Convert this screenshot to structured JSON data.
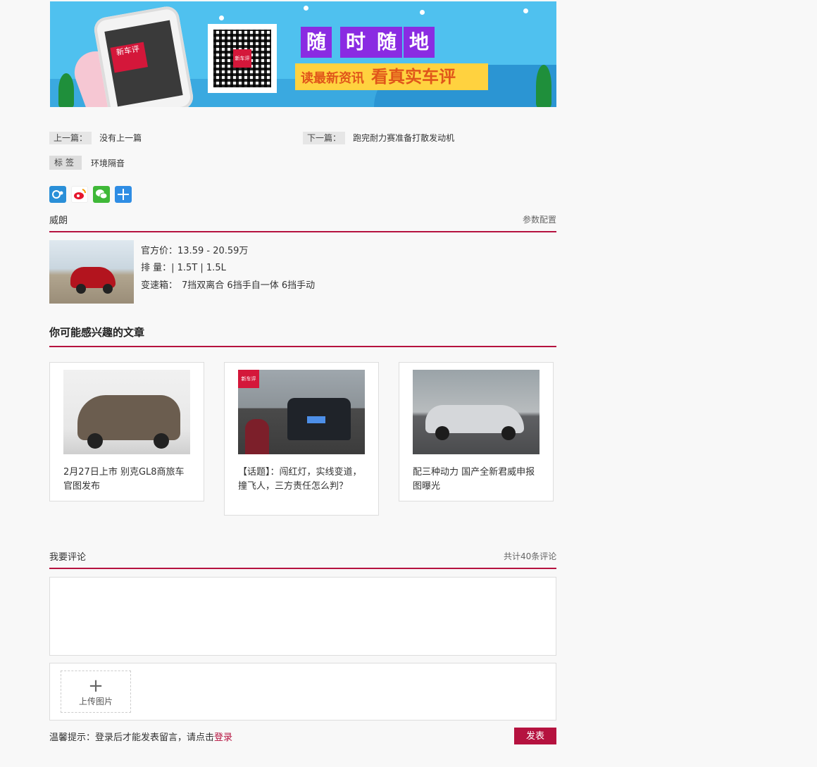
{
  "banner": {
    "phone_logo": "新车评",
    "qr_logo": "新车评",
    "slogan_chars": [
      "随",
      "时",
      "随",
      "地"
    ],
    "sub_small": "读最新资讯",
    "sub_large": "看真实车评"
  },
  "nav": {
    "prev_label": "上一篇：",
    "prev_text": "没有上一篇",
    "next_label": "下一篇：",
    "next_text": "跑完耐力赛准备打散发动机"
  },
  "tags": {
    "label": "标签",
    "items": [
      "环境隔音"
    ]
  },
  "share": {
    "icons": [
      "qzone-icon",
      "weibo-icon",
      "wechat-icon",
      "more-share-icon"
    ]
  },
  "car": {
    "name": "威朗",
    "params_link": "参数配置",
    "price_label": "官方价：",
    "price_value": "13.59 - 20.59万",
    "displacement_label": "排 量：",
    "displacement_value": "| 1.5T | 1.5L",
    "gearbox_label": "变速箱：",
    "gearbox_value": "7挡双离合 6挡手自一体 6挡手动"
  },
  "related": {
    "title": "你可能感兴趣的文章",
    "articles": [
      {
        "caption": "2月27日上市 别克GL8商旅车官图发布"
      },
      {
        "caption": "【话题】：闯红灯，实线变道，撞飞人，三方责任怎么判？"
      },
      {
        "caption": "配三种动力 国产全新君威申报图曝光"
      }
    ]
  },
  "comments": {
    "title": "我要评论",
    "count_text": "共计40条评论",
    "upload_label": "上传图片",
    "upload_plus": "+",
    "tip_prefix": "温馨提示：登录后才能发表留言，请点击",
    "login_link": "登录",
    "submit_label": "发表"
  },
  "colors": {
    "accent": "#b5123f",
    "banner_bg": "#4fc1ef"
  }
}
